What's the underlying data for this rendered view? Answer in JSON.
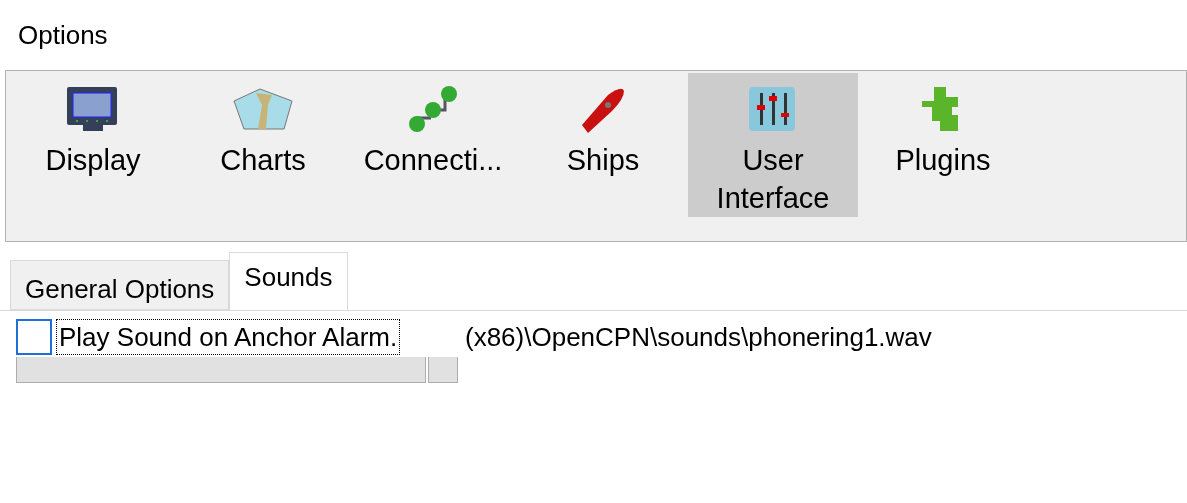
{
  "window": {
    "title": "Options"
  },
  "toolbar": [
    {
      "label": "Display",
      "kind": "display",
      "selected": false
    },
    {
      "label": "Charts",
      "kind": "charts",
      "selected": false
    },
    {
      "label": "Connecti...",
      "kind": "connections",
      "selected": false
    },
    {
      "label": "Ships",
      "kind": "ships",
      "selected": false
    },
    {
      "label": "User Interface",
      "kind": "ui",
      "selected": true
    },
    {
      "label": "Plugins",
      "kind": "plugins",
      "selected": false
    }
  ],
  "tabs": [
    {
      "label": "General Options",
      "selected": false
    },
    {
      "label": "Sounds",
      "selected": true
    }
  ],
  "anchor_alarm": {
    "checkbox": {
      "label": "Play Sound on Anchor Alarm.",
      "checked": false
    },
    "sound_file": "(x86)\\OpenCPN\\sounds\\phonering1.wav"
  }
}
